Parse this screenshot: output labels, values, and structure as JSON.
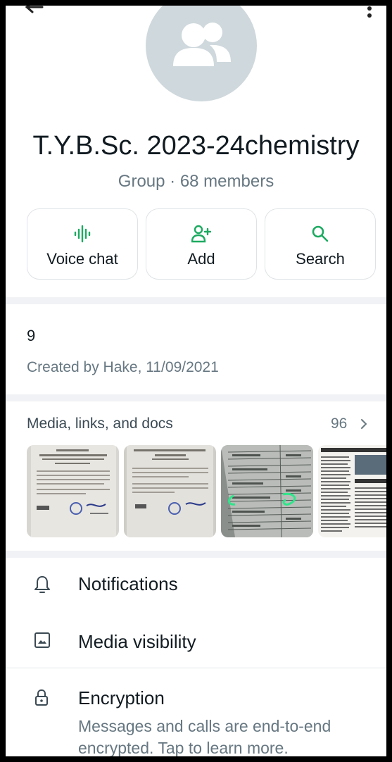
{
  "group": {
    "name": "T.Y.B.Sc. 2023-24chemistry",
    "subtitle": "Group · 68 members"
  },
  "actions": [
    {
      "label": "Voice chat",
      "icon": "voice-chat-icon"
    },
    {
      "label": "Add",
      "icon": "add-person-icon"
    },
    {
      "label": "Search",
      "icon": "search-icon"
    }
  ],
  "description": {
    "text": "9",
    "created": "Created by Hake, 11/09/2021"
  },
  "media": {
    "title": "Media, links, and docs",
    "count": "96"
  },
  "settings": [
    {
      "label": "Notifications",
      "icon": "bell-icon"
    },
    {
      "label": "Media visibility",
      "icon": "image-icon"
    }
  ],
  "encryption": {
    "title": "Encryption",
    "subtitle": "Messages and calls are end-to-end encrypted. Tap to learn more."
  },
  "colors": {
    "accent": "#1daa61",
    "avatar_bg": "#cfd8dc",
    "section_divider": "#f0f2f5"
  }
}
